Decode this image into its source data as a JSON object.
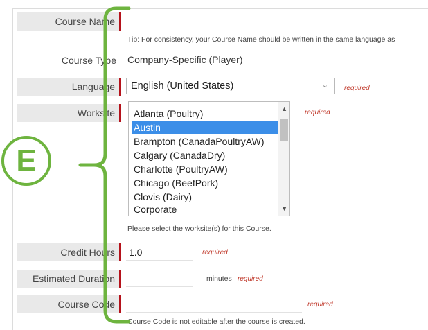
{
  "form": {
    "course_name": {
      "label": "Course Name",
      "value": "",
      "tip": "Tip: For consistency, your Course Name should be written in the same language as"
    },
    "course_type": {
      "label": "Course Type",
      "value": "Company-Specific (Player)"
    },
    "language": {
      "label": "Language",
      "selected": "English (United States)",
      "required": "required"
    },
    "worksite": {
      "label": "Worksite",
      "required": "required",
      "options": [
        "Atlanta (Poultry)",
        "Austin",
        "Brampton (CanadaPoultryAW)",
        "Calgary (CanadaDry)",
        "Charlotte (PoultryAW)",
        "Chicago (BeefPork)",
        "Clovis (Dairy)",
        "Corporate"
      ],
      "selected_option": "Austin",
      "help": "Please select the worksite(s) for this Course."
    },
    "credit_hours": {
      "label": "Credit Hours",
      "value": "1.0",
      "required": "required"
    },
    "estimated_duration": {
      "label": "Estimated Duration",
      "value": "",
      "unit": "minutes",
      "required": "required"
    },
    "course_code": {
      "label": "Course Code",
      "value": "",
      "required": "required",
      "note": "Course Code is not editable after the course is created."
    }
  },
  "annotation": {
    "letter": "E",
    "color": "#6eb43f"
  },
  "colors": {
    "required_text": "#c0392b",
    "label_bar": "#b5121b",
    "list_selection": "#3b8ee8"
  }
}
